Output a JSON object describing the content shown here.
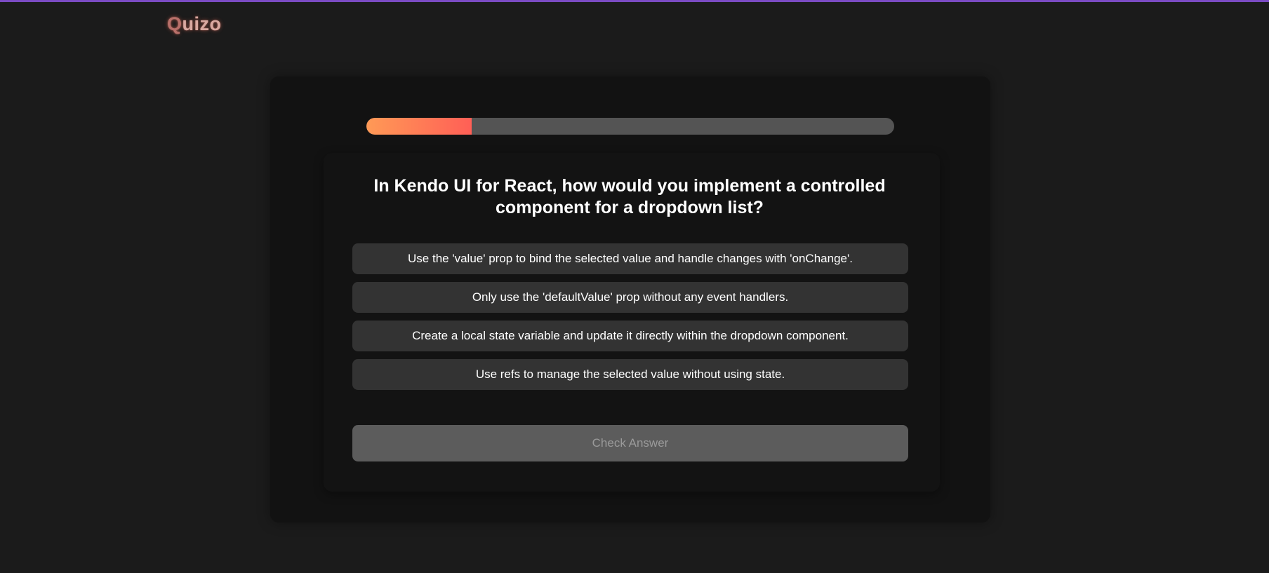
{
  "app": {
    "logo_first_letter": "Q",
    "logo_rest": "uizo",
    "accent_color": "#7b4bc4"
  },
  "progress": {
    "fraction": 0.2,
    "fill_gradient": [
      "#ff9a56",
      "#ff5f56"
    ]
  },
  "quiz": {
    "question": "In Kendo UI for React, how would you implement a controlled component for a dropdown list?",
    "options": [
      "Use the 'value' prop to bind the selected value and handle changes with 'onChange'.",
      "Only use the 'defaultValue' prop without any event handlers.",
      "Create a local state variable and update it directly within the dropdown component.",
      "Use refs to manage the selected value without using state."
    ],
    "check_label": "Check Answer"
  }
}
